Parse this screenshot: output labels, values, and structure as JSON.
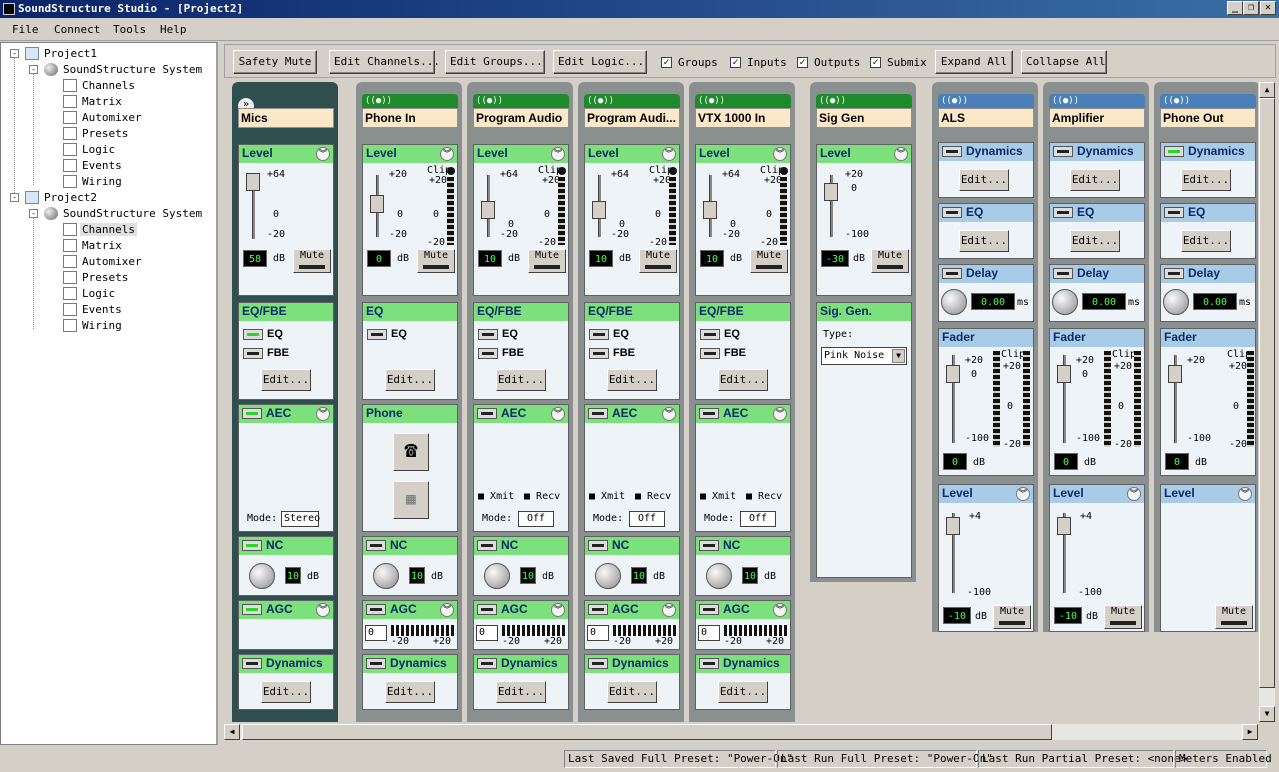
{
  "window": {
    "title": "SoundStructure Studio - [Project2]",
    "min": "_",
    "restore": "❐",
    "close": "✕"
  },
  "menu": [
    "File",
    "Connect",
    "Tools",
    "Help"
  ],
  "tree": {
    "project1": {
      "label": "Project1",
      "system": "SoundStructure System",
      "items": [
        "Channels",
        "Matrix",
        "Automixer",
        "Presets",
        "Logic",
        "Events",
        "Wiring"
      ]
    },
    "project2": {
      "label": "Project2",
      "system": "SoundStructure System",
      "items": [
        "Channels",
        "Matrix",
        "Automixer",
        "Presets",
        "Logic",
        "Events",
        "Wiring"
      ],
      "selected": "Channels"
    }
  },
  "toolbar": {
    "safety_mute": "Safety Mute",
    "edit_channels": "Edit Channels...",
    "edit_groups": "Edit Groups...",
    "edit_logic": "Edit Logic...",
    "groups": "Groups",
    "inputs": "Inputs",
    "outputs": "Outputs",
    "submix": "Submix",
    "expand_all": "Expand All",
    "collapse_all": "Collapse All"
  },
  "labels": {
    "level": "Level",
    "eqfbe": "EQ/FBE",
    "eq": "EQ",
    "fbe": "FBE",
    "edit": "Edit...",
    "aec": "AEC",
    "nc": "NC",
    "agc": "AGC",
    "dynamics": "Dynamics",
    "phone": "Phone",
    "mute": "Mute",
    "db": "dB",
    "clip": "Clip",
    "mode": "Mode:",
    "xmit": "Xmit",
    "recv": "Recv",
    "delay": "Delay",
    "fader": "Fader",
    "ms": "ms",
    "type": "Type:",
    "siggen": "Sig. Gen.",
    "plus20": "+20",
    "minus20": "-20",
    "minus100": "-100",
    "zero": "0",
    "plus64": "+64",
    "plus4": "+4"
  },
  "channels": [
    {
      "name": "Mics",
      "gain": "58",
      "aec_mode": "Stereo",
      "nc": "10",
      "agc_val": ""
    },
    {
      "name": "Phone In",
      "gain": "0",
      "nc": "10",
      "agc_val": "0"
    },
    {
      "name": "Program Audio",
      "gain": "10",
      "aec_mode": "Off",
      "nc": "10",
      "agc_val": "0"
    },
    {
      "name": "Program Audi...",
      "gain": "10",
      "aec_mode": "Off",
      "nc": "10",
      "agc_val": "0"
    },
    {
      "name": "VTX 1000 In",
      "gain": "10",
      "aec_mode": "Off",
      "nc": "10",
      "agc_val": "0"
    },
    {
      "name": "Sig Gen",
      "gain": "-30",
      "type": "Pink Noise"
    },
    {
      "name": "ALS",
      "delay": "0.00",
      "fader": "0",
      "level": "-10"
    },
    {
      "name": "Amplifier",
      "delay": "0.00",
      "fader": "0",
      "level": "-10"
    },
    {
      "name": "Phone Out",
      "delay": "0.00",
      "fader": "0"
    }
  ],
  "status": {
    "saved": "Last Saved Full Preset: \"Power-On\"",
    "run_full": "Last Run Full Preset: \"Power-On\"",
    "run_partial": "Last Run Partial Preset: <none>",
    "meters": "Meters Enabled"
  },
  "colors": {
    "input_header": "#1f8a2a",
    "output_header": "#4a7fb8",
    "block_green": "#7ce07c",
    "block_blue": "#a8cce8",
    "name_bg": "#fbe8c8",
    "bg": "#d4d0c8"
  }
}
